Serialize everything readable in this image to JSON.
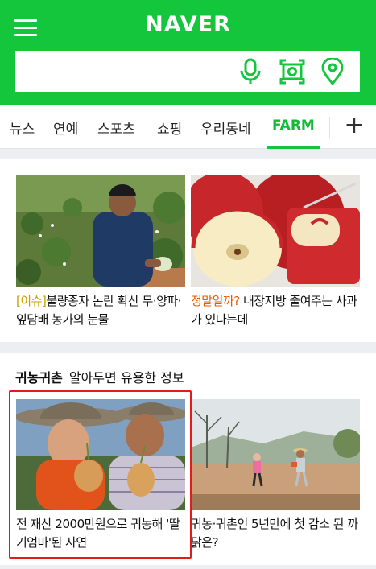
{
  "header": {
    "logo": "NAVER",
    "search_placeholder": "",
    "icons": [
      "menu-icon",
      "microphone-icon",
      "lens-icon",
      "location-pin-icon"
    ],
    "brand_color": "#14c63c"
  },
  "tabs": {
    "items": [
      {
        "label": "뉴스"
      },
      {
        "label": "연예"
      },
      {
        "label": "스포츠"
      },
      {
        "label": "쇼핑"
      },
      {
        "label": "우리동네"
      },
      {
        "label": "FARM",
        "active": true
      }
    ],
    "add_label": "+"
  },
  "card1": {
    "articles": [
      {
        "tag": "[이슈]",
        "title": "불량종자 논란 확산 무·양파·잎담배 농가의 눈물"
      },
      {
        "tag": "정말일까?",
        "title": " 내장지방 줄여주는 사과가 있다는데"
      }
    ]
  },
  "card2": {
    "section_title": "귀농귀촌",
    "section_subtitle": "알아두면 유용한 정보",
    "articles": [
      {
        "title": "전 재산 2000만원으로 귀농해 '딸기엄마'된 사연"
      },
      {
        "title": "귀농·귀촌인 5년만에 첫 감소 된 까닭은?"
      }
    ]
  }
}
